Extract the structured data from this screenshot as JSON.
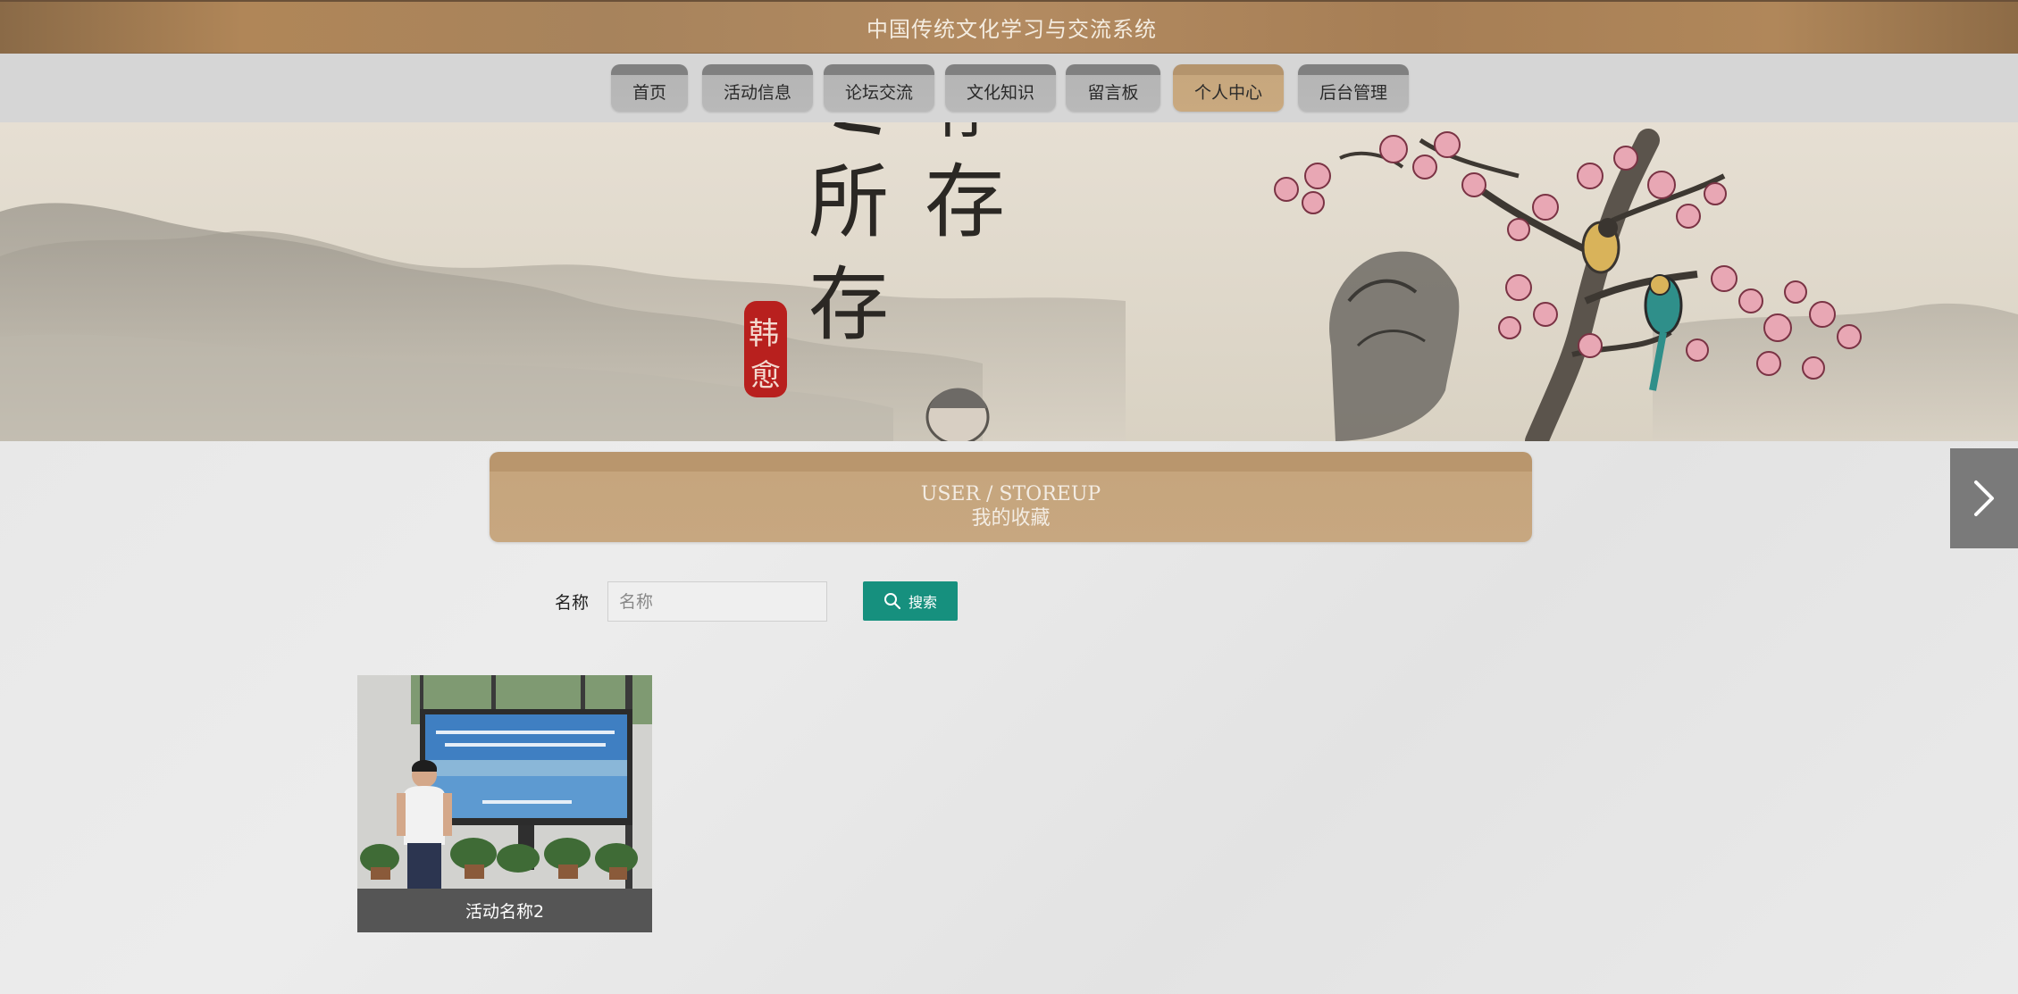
{
  "header": {
    "title": "中国传统文化学习与交流系统"
  },
  "nav": {
    "items": [
      {
        "label": "首页"
      },
      {
        "label": "活动信息"
      },
      {
        "label": "论坛交流"
      },
      {
        "label": "文化知识"
      },
      {
        "label": "留言板"
      },
      {
        "label": "个人中心",
        "active": true
      },
      {
        "label": "后台管理"
      }
    ]
  },
  "banner": {
    "calligraphy": [
      "所",
      "存",
      "存",
      "存"
    ],
    "seal": "韩愈"
  },
  "section": {
    "en_title": "USER / STOREUP",
    "cn_title": "我的收藏"
  },
  "search": {
    "label": "名称",
    "placeholder": "名称",
    "value": "",
    "button_label": "搜索"
  },
  "cards": [
    {
      "title": "活动名称2"
    }
  ],
  "colors": {
    "accent": "#16907e",
    "header_brown": "#b08658",
    "active_tab": "#c9a97f"
  },
  "icons": {
    "search": "search-icon",
    "next": "chevron-right-icon"
  }
}
